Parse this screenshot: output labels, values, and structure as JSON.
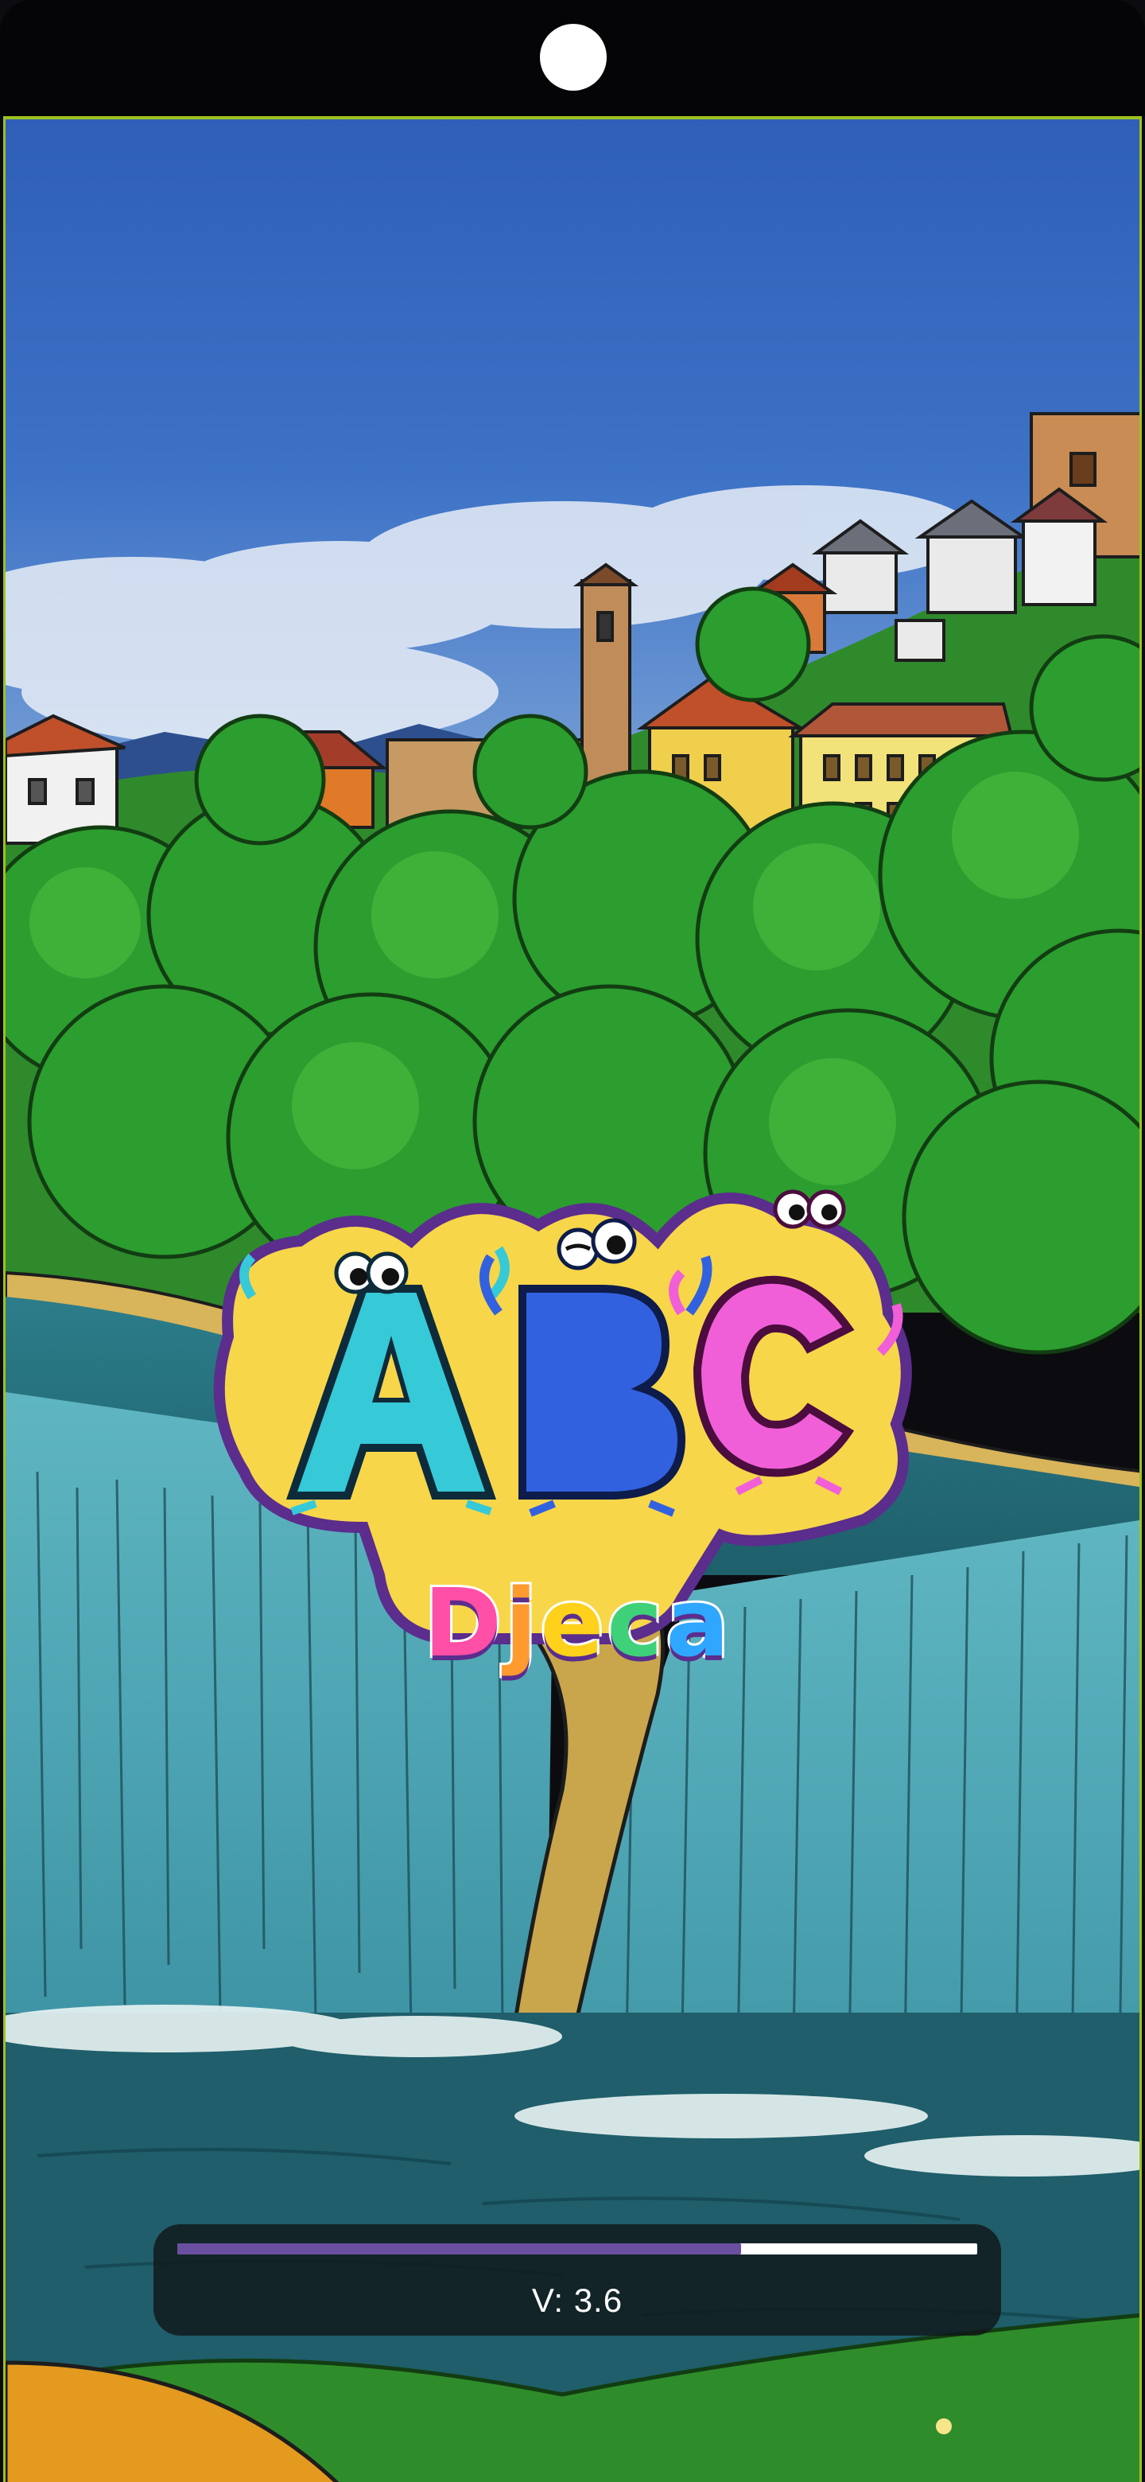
{
  "app": {
    "logo_letters": [
      "A",
      "B",
      "C"
    ],
    "logo_word_letters": [
      "D",
      "j",
      "e",
      "c",
      "a"
    ],
    "logo_word_colors": [
      "#ff4fa6",
      "#ff9a2e",
      "#ffd11a",
      "#3fd17a",
      "#2fa7ff"
    ]
  },
  "loader": {
    "progress_fraction": 0.705,
    "version_text": "V: 3.6"
  },
  "colors": {
    "frame_accent": "#9ec21f",
    "progress_fill": "#6a4fa1",
    "progress_track": "#ffffff",
    "status_bar": "#050507"
  },
  "icons": {
    "camera": "front-camera-icon"
  }
}
